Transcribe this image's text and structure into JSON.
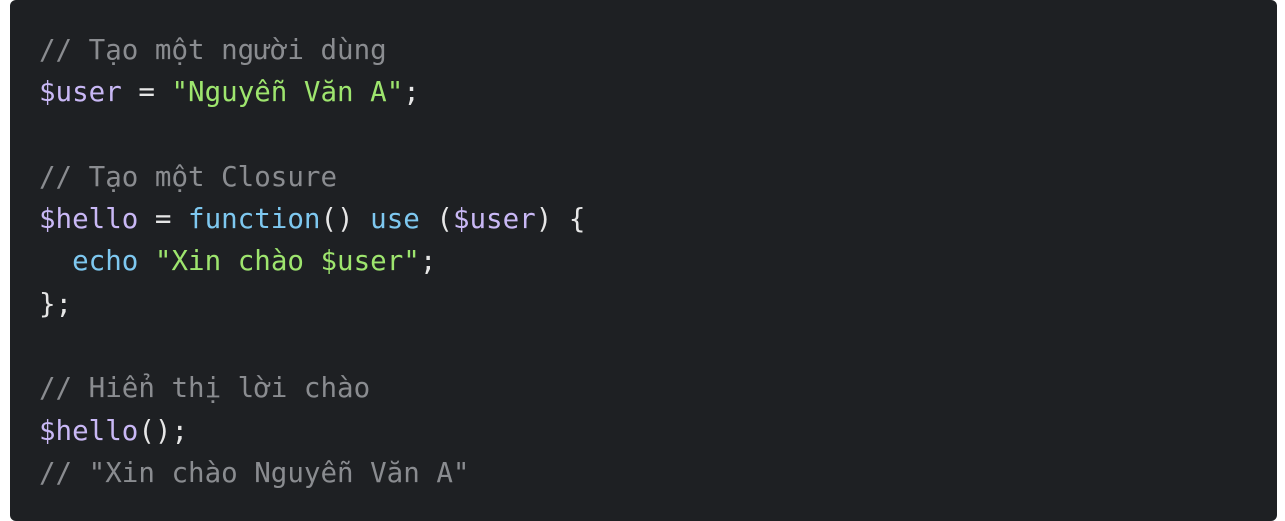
{
  "code": {
    "language": "php",
    "lines": [
      [
        {
          "t": "// Tạo một người dùng",
          "k": "comment"
        }
      ],
      [
        {
          "t": "$user",
          "k": "var"
        },
        {
          "t": " = ",
          "k": "punc"
        },
        {
          "t": "\"Nguyễn Văn A\"",
          "k": "str"
        },
        {
          "t": ";",
          "k": "punc"
        }
      ],
      [],
      [
        {
          "t": "// Tạo một Closure",
          "k": "comment"
        }
      ],
      [
        {
          "t": "$hello",
          "k": "var"
        },
        {
          "t": " = ",
          "k": "punc"
        },
        {
          "t": "function",
          "k": "kw"
        },
        {
          "t": "() ",
          "k": "punc"
        },
        {
          "t": "use",
          "k": "kw"
        },
        {
          "t": " (",
          "k": "punc"
        },
        {
          "t": "$user",
          "k": "var"
        },
        {
          "t": ") {",
          "k": "punc"
        }
      ],
      [
        {
          "t": "  ",
          "k": "punc"
        },
        {
          "t": "echo",
          "k": "kw"
        },
        {
          "t": " ",
          "k": "punc"
        },
        {
          "t": "\"Xin chào $user\"",
          "k": "str"
        },
        {
          "t": ";",
          "k": "punc"
        }
      ],
      [
        {
          "t": "};",
          "k": "punc"
        }
      ],
      [],
      [
        {
          "t": "// Hiển thị lời chào",
          "k": "comment"
        }
      ],
      [
        {
          "t": "$hello",
          "k": "var"
        },
        {
          "t": "();",
          "k": "punc"
        }
      ],
      [
        {
          "t": "// \"Xin chào Nguyễn Văn A\"",
          "k": "comment"
        }
      ]
    ]
  },
  "colors": {
    "background": "#1e2023",
    "comment": "#8a8c90",
    "variable": "#c9b8f5",
    "string": "#9ee56e",
    "keyword": "#7ec8f0",
    "punctuation": "#e6e6e6"
  }
}
